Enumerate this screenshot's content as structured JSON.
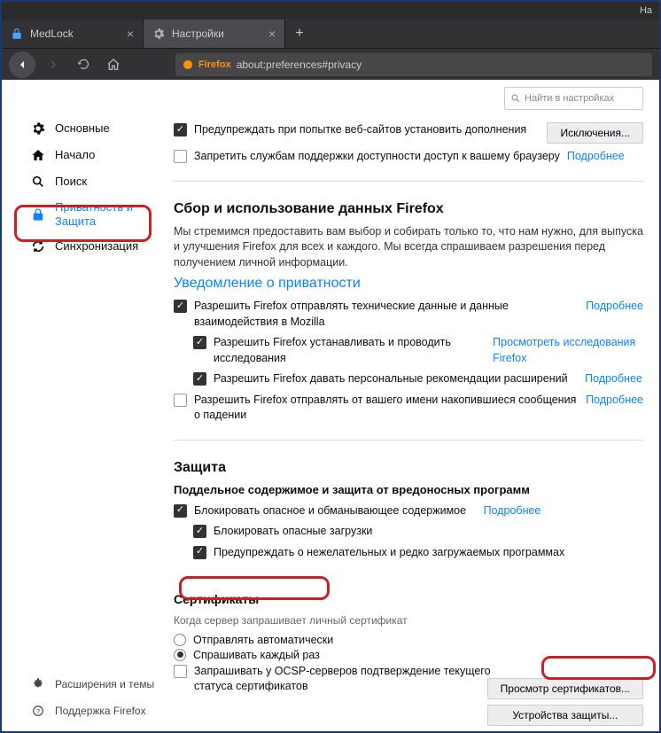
{
  "window": {
    "title_fragment": "На"
  },
  "tabs": [
    {
      "label": "MedLock",
      "icon": "lock-icon"
    },
    {
      "label": "Настройки",
      "icon": "gear-icon"
    }
  ],
  "urlbar": {
    "brand": "Firefox",
    "url": "about:preferences#privacy"
  },
  "search": {
    "placeholder": "Найти в настройках"
  },
  "sidebar": {
    "items": [
      {
        "label": "Основные",
        "icon": "gear-icon"
      },
      {
        "label": "Начало",
        "icon": "home-icon"
      },
      {
        "label": "Поиск",
        "icon": "search-icon"
      },
      {
        "label": "Приватность и Защита",
        "icon": "lock-icon",
        "active": true
      },
      {
        "label": "Синхронизация",
        "icon": "sync-icon"
      }
    ],
    "footer": [
      {
        "label": "Расширения и темы",
        "icon": "puzzle-icon"
      },
      {
        "label": "Поддержка Firefox",
        "icon": "help-icon"
      }
    ]
  },
  "top_checks": {
    "warn_addon": "Предупреждать при попытке веб-сайтов установить дополнения",
    "exceptions_btn": "Исключения...",
    "block_a11y": "Запретить службам поддержки доступности доступ к вашему браузеру",
    "more": "Подробнее"
  },
  "data_collection": {
    "title": "Сбор и использование данных Firefox",
    "desc": "Мы стремимся предоставить вам выбор и собирать только то, что нам нужно, для выпуска и улучшения Firefox для всех и каждого. Мы всегда спрашиваем разрешения перед получением личной информации.",
    "privacy_link": "Уведомление о приватности",
    "c1": "Разрешить Firefox отправлять технические данные и данные взаимодействия в Mozilla",
    "c1_link": "Подробнее",
    "c2": "Разрешить Firefox устанавливать и проводить исследования",
    "c2_link": "Просмотреть исследования Firefox",
    "c3": "Разрешить Firefox давать персональные рекомендации расширений",
    "c3_link": "Подробнее",
    "c4": "Разрешить Firefox отправлять от вашего имени накопившиеся сообщения о падении",
    "c4_link": "Подробнее"
  },
  "security": {
    "title": "Защита",
    "sub1": "Поддельное содержимое и защита от вредоносных программ",
    "s1": "Блокировать опасное и обманывающее содержимое",
    "s1_link": "Подробнее",
    "s2": "Блокировать опасные загрузки",
    "s3": "Предупреждать о нежелательных и редко загружаемых программах"
  },
  "certs": {
    "title": "Сертификаты",
    "desc": "Когда сервер запрашивает личный сертификат",
    "r1": "Отправлять автоматически",
    "r2": "Спрашивать каждый раз",
    "ocsp": "Запрашивать у OCSP-серверов подтверждение текущего статуса сертификатов",
    "view_btn": "Просмотр сертификатов...",
    "devices_btn": "Устройства защиты..."
  }
}
